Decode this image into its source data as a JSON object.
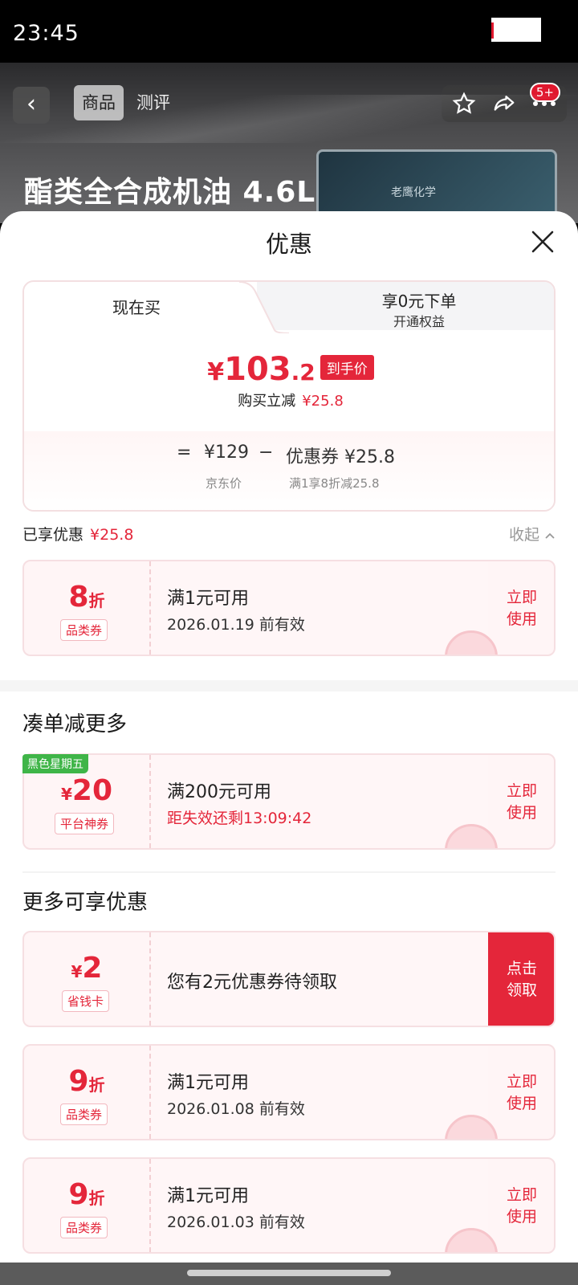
{
  "status_bar": {
    "time": "23:45"
  },
  "header": {
    "tabs": [
      "商品",
      "测评"
    ],
    "badge": "5+",
    "product_title": "酯类全合成机油 4.6L",
    "product_image_text": "老鹰化学"
  },
  "sheet": {
    "title": "优惠",
    "price_card": {
      "tab_now": "现在买",
      "tab_zero": "享0元下单",
      "tab_zero_sub": "开通权益",
      "price_yen": "¥",
      "price_int": "103",
      "price_dec": ".2",
      "price_tag": "到手价",
      "discount_label": "购买立减",
      "discount_value": "¥25.8",
      "formula_eq": "=",
      "formula_price": "¥129",
      "formula_minus": "−",
      "formula_coupon": "优惠券 ¥25.8",
      "jd_price_label": "京东价",
      "coupon_rule": "满1享8折减25.8"
    },
    "enjoyed": {
      "label": "已享优惠",
      "value": "¥25.8",
      "collapse": "收起"
    },
    "coupons_enjoyed": [
      {
        "value_big": "8",
        "value_small": "折",
        "type": "品类券",
        "condition": "满1元可用",
        "date": "2026.01.19 前有效",
        "action": "立即\n使用"
      }
    ],
    "section_more_combine": "凑单减更多",
    "coupon_combine": {
      "tag": "黑色星期五",
      "value_small": "¥",
      "value_big": "20",
      "type": "平台神券",
      "condition": "满200元可用",
      "date": "距失效还剩13:09:42",
      "action": "立即\n使用"
    },
    "section_more": "更多可享优惠",
    "coupon_claim": {
      "value_small": "¥",
      "value_big": "2",
      "type": "省钱卡",
      "text": "您有2元优惠券待领取",
      "action": "点击\n领取"
    },
    "coupons_more": [
      {
        "value_big": "9",
        "value_small": "折",
        "type": "品类券",
        "condition": "满1元可用",
        "date": "2026.01.08 前有效",
        "action": "立即\n使用"
      },
      {
        "value_big": "9",
        "value_small": "折",
        "type": "品类券",
        "condition": "满1元可用",
        "date": "2026.01.03 前有效",
        "action": "立即\n使用"
      }
    ]
  }
}
